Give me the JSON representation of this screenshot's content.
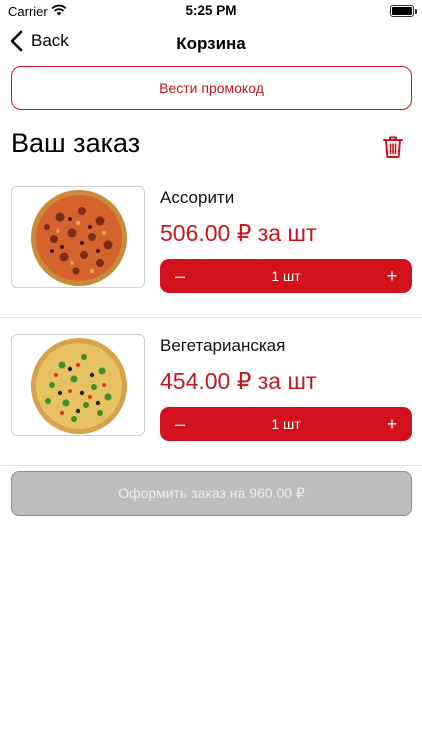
{
  "status_bar": {
    "carrier": "Carrier",
    "time": "5:25 PM"
  },
  "nav": {
    "back_label": "Back",
    "title": "Корзина"
  },
  "promo": {
    "label": "Вести промокод"
  },
  "order": {
    "title": "Ваш заказ"
  },
  "items": [
    {
      "name": "Ассорити",
      "price": "506.00 ₽ за шт",
      "quantity": "1 шт",
      "minus": "–",
      "plus": "+"
    },
    {
      "name": "Вегетарианская",
      "price": "454.00 ₽ за шт",
      "quantity": "1 шт",
      "minus": "–",
      "plus": "+"
    }
  ],
  "checkout": {
    "label": "Оформить заказ на 960.00 ₽"
  },
  "colors": {
    "accent": "#d1111b",
    "disabled_button": "#bdbdbd"
  }
}
